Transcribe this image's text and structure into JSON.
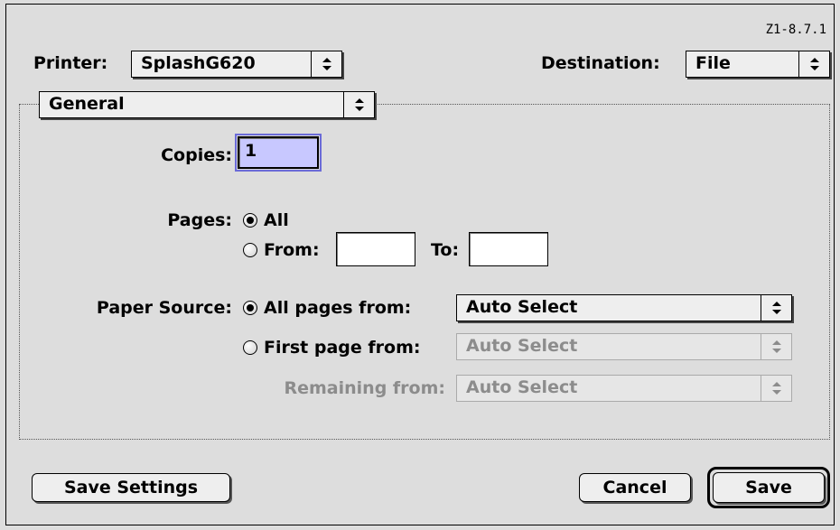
{
  "version": "Z1-8.7.1",
  "printer": {
    "label": "Printer:",
    "value": "SplashG620"
  },
  "destination": {
    "label": "Destination:",
    "value": "File"
  },
  "panel": {
    "value": "General"
  },
  "copies": {
    "label": "Copies:",
    "value": "1"
  },
  "pages": {
    "label": "Pages:",
    "all_label": "All",
    "all_selected": true,
    "from_label": "From:",
    "from_value": "",
    "to_label": "To:",
    "to_value": ""
  },
  "paper_source": {
    "label": "Paper Source:",
    "all_pages_label": "All pages from:",
    "all_pages_selected": true,
    "all_pages_value": "Auto Select",
    "first_page_label": "First page from:",
    "first_page_value": "Auto Select",
    "remaining_label": "Remaining from:",
    "remaining_value": "Auto Select"
  },
  "buttons": {
    "save_settings": "Save Settings",
    "cancel": "Cancel",
    "save": "Save"
  },
  "icons": {
    "popup_arrows": "up-down-arrows-icon"
  }
}
